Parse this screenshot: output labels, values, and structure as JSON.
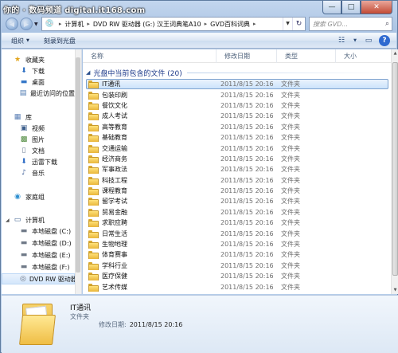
{
  "watermark": "你的 · 数码频道 digital.it168.com",
  "window": {
    "buttons": {
      "minimize": "—",
      "maximize": "□",
      "close": "✕"
    }
  },
  "address": {
    "crumbs": [
      "计算机",
      "DVD RW 驱动器 (G:) 汉王词典笔A10",
      "GVD百科词典"
    ],
    "search_placeholder": "搜索 GVD..."
  },
  "toolbar": {
    "organize": "组织",
    "burn": "刻录到光盘"
  },
  "nav": {
    "favorites": "收藏夹",
    "downloads": "下载",
    "desktop": "桌面",
    "recent": "最近访问的位置",
    "libraries": "库",
    "videos": "视频",
    "pictures": "图片",
    "documents": "文档",
    "thunder": "迅雷下载",
    "music": "音乐",
    "homegroup": "家庭组",
    "computer": "计算机",
    "disk_c": "本地磁盘 (C:)",
    "disk_d": "本地磁盘 (D:)",
    "disk_e": "本地磁盘 (E:)",
    "disk_f": "本地磁盘 (F:)",
    "dvd": "DVD RW 驱动器"
  },
  "columns": {
    "name": "名称",
    "date": "修改日期",
    "type": "类型",
    "size": "大小"
  },
  "group_title": "光盘中当前包含的文件 (20)",
  "files": [
    {
      "name": "IT通讯",
      "date": "2011/8/15 20:16",
      "type": "文件夹"
    },
    {
      "name": "包装印刷",
      "date": "2011/8/15 20:16",
      "type": "文件夹"
    },
    {
      "name": "餐饮文化",
      "date": "2011/8/15 20:16",
      "type": "文件夹"
    },
    {
      "name": "成人考试",
      "date": "2011/8/15 20:16",
      "type": "文件夹"
    },
    {
      "name": "高等教育",
      "date": "2011/8/15 20:16",
      "type": "文件夹"
    },
    {
      "name": "基础教育",
      "date": "2011/8/15 20:16",
      "type": "文件夹"
    },
    {
      "name": "交通运输",
      "date": "2011/8/15 20:16",
      "type": "文件夹"
    },
    {
      "name": "经济商务",
      "date": "2011/8/15 20:16",
      "type": "文件夹"
    },
    {
      "name": "军事政法",
      "date": "2011/8/15 20:16",
      "type": "文件夹"
    },
    {
      "name": "科技工程",
      "date": "2011/8/15 20:16",
      "type": "文件夹"
    },
    {
      "name": "课程教育",
      "date": "2011/8/15 20:16",
      "type": "文件夹"
    },
    {
      "name": "留学考试",
      "date": "2011/8/15 20:16",
      "type": "文件夹"
    },
    {
      "name": "贸易金融",
      "date": "2011/8/15 20:16",
      "type": "文件夹"
    },
    {
      "name": "求职应聘",
      "date": "2011/8/15 20:16",
      "type": "文件夹"
    },
    {
      "name": "日常生活",
      "date": "2011/8/15 20:16",
      "type": "文件夹"
    },
    {
      "name": "生物地理",
      "date": "2011/8/15 20:16",
      "type": "文件夹"
    },
    {
      "name": "体育赛事",
      "date": "2011/8/15 20:16",
      "type": "文件夹"
    },
    {
      "name": "学科行业",
      "date": "2011/8/15 20:16",
      "type": "文件夹"
    },
    {
      "name": "医疗保健",
      "date": "2011/8/15 20:16",
      "type": "文件夹"
    },
    {
      "name": "艺术传媒",
      "date": "2011/8/15 20:16",
      "type": "文件夹"
    }
  ],
  "details": {
    "name": "IT通讯",
    "type": "文件夹",
    "modified_label": "修改日期:",
    "modified_value": "2011/8/15 20:16"
  }
}
